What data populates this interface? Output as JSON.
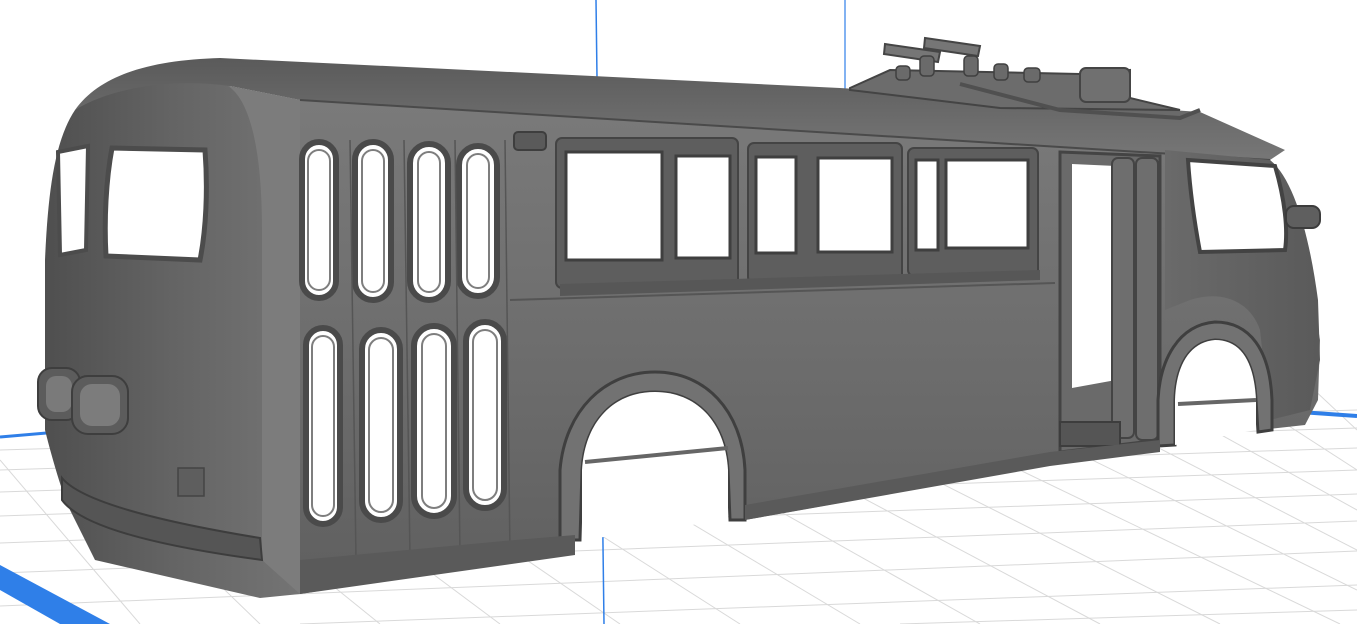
{
  "scene": {
    "view": "3d-perspective",
    "background_color": "#ffffff",
    "grid_color": "#d9d9d9",
    "model": {
      "name": "",
      "material_color": "#6e6e6e"
    },
    "axes": {
      "x_axis_color": "#2f7fe8",
      "y_axis_color": "#2f7fe8",
      "z_axis_color": "#2f7fe8"
    }
  }
}
